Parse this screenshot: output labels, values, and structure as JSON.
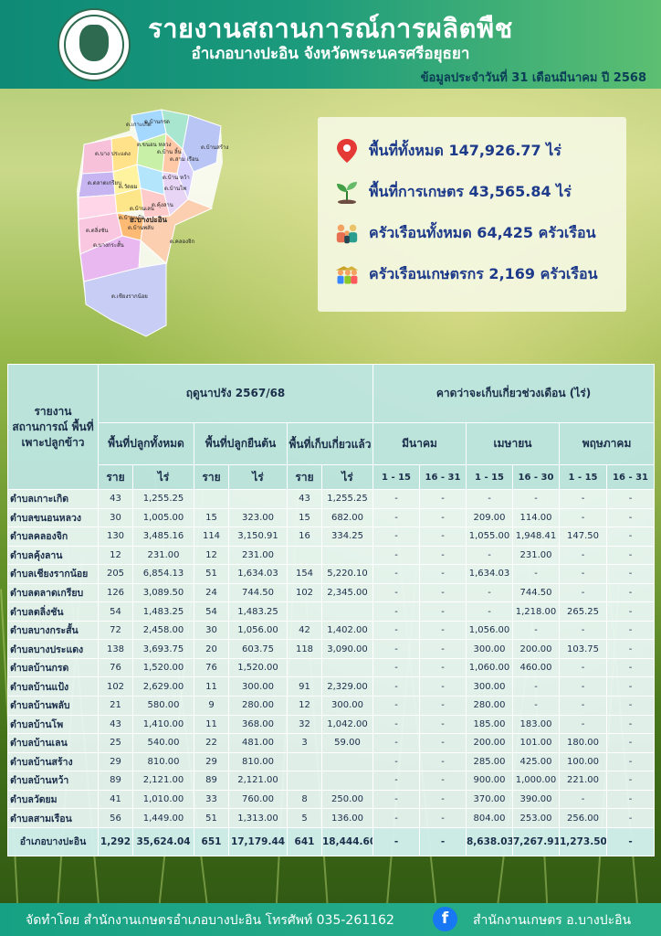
{
  "header": {
    "title": "รายงานสถานการณ์การผลิตพืช",
    "subtitle": "อำเภอบางปะอิน จังหวัดพระนครศรีอยุธยา",
    "date": "ข้อมูลประจำวันที่  31  เดือนมีนาคม ปี 2568"
  },
  "map": {
    "labels": [
      "ต.บ้านกรด",
      "ต.ขนอน หลวง",
      "ต.บาง ประแดง",
      "ต.ตลาดเกรียบ",
      "ต.วัดยม",
      "ต.บ้านแป้ง",
      "ต.บ้านพลับ",
      "ต.บ้านเลน",
      "ต.บ้านโพ",
      "ต.คุ้งลาน",
      "ต.สาม เรือน",
      "ต.บ้านสร้าง",
      "ต.บ้าน หว้า",
      "ต.เกาะเกิด",
      "ต.บางกระสั้น",
      "ต.คลองจิก",
      "ต.เชียงรากน้อย",
      "อ.บางปะอิน",
      "ต.ตลิ่งชัน",
      "ต.บ้าน ลิ้น"
    ]
  },
  "info": {
    "total_area": "พื้นที่ทั้งหมด 147,926.77 ไร่",
    "agri_area": "พื้นที่การเกษตร 43,565.84 ไร่",
    "households": "ครัวเรือนทั้งหมด 64,425 ครัวเรือน",
    "farm_households": "ครัวเรือนเกษตรกร 2,169 ครัวเรือน"
  },
  "table": {
    "h_report": "รายงาน สถานการณ์ พื้นที่ เพาะปลูกข้าว",
    "h_season": "ฤดูนาปรัง 2567/68",
    "h_forecast": "คาดว่าจะเก็บเกี่ยวช่วงเดือน (ไร่)",
    "h_planted": "พื้นที่ปลูกทั้งหมด",
    "h_standing": "พื้นที่ปลูกยืนต้น",
    "h_harvested": "พื้นที่เก็บเกี่ยวแล้ว",
    "h_mar": "มีนาคม",
    "h_apr": "เมษายน",
    "h_may": "พฤษภาคม",
    "u_rai": "ราย",
    "u_area": "ไร่",
    "p_mar1": "1 - 15",
    "p_mar2": "16 - 31",
    "p_apr1": "1 - 15",
    "p_apr2": "16 - 30",
    "p_may1": "1 - 15",
    "p_may2": "16 - 31",
    "rows": [
      [
        "ตำบลเกาะเกิด",
        "43",
        "1,255.25",
        "",
        "",
        "43",
        "1,255.25",
        "-",
        "-",
        "-",
        "-",
        "-",
        "-"
      ],
      [
        "ตำบลขนอนหลวง",
        "30",
        "1,005.00",
        "15",
        "323.00",
        "15",
        "682.00",
        "-",
        "-",
        "209.00",
        "114.00",
        "-",
        "-"
      ],
      [
        "ตำบลคลองจิก",
        "130",
        "3,485.16",
        "114",
        "3,150.91",
        "16",
        "334.25",
        "-",
        "-",
        "1,055.00",
        "1,948.41",
        "147.50",
        "-"
      ],
      [
        "ตำบลคุ้งลาน",
        "12",
        "231.00",
        "12",
        "231.00",
        "",
        "",
        "-",
        "-",
        "-",
        "231.00",
        "-",
        "-"
      ],
      [
        "ตำบลเชียงรากน้อย",
        "205",
        "6,854.13",
        "51",
        "1,634.03",
        "154",
        "5,220.10",
        "-",
        "-",
        "1,634.03",
        "-",
        "-",
        "-"
      ],
      [
        "ตำบลตลาดเกรียบ",
        "126",
        "3,089.50",
        "24",
        "744.50",
        "102",
        "2,345.00",
        "-",
        "-",
        "-",
        "744.50",
        "-",
        "-"
      ],
      [
        "ตำบลตลิ่งชัน",
        "54",
        "1,483.25",
        "54",
        "1,483.25",
        "",
        "",
        "-",
        "-",
        "-",
        "1,218.00",
        "265.25",
        "-"
      ],
      [
        "ตำบลบางกระสั้น",
        "72",
        "2,458.00",
        "30",
        "1,056.00",
        "42",
        "1,402.00",
        "-",
        "-",
        "1,056.00",
        "-",
        "-",
        "-"
      ],
      [
        "ตำบลบางประแดง",
        "138",
        "3,693.75",
        "20",
        "603.75",
        "118",
        "3,090.00",
        "-",
        "-",
        "300.00",
        "200.00",
        "103.75",
        "-"
      ],
      [
        "ตำบลบ้านกรด",
        "76",
        "1,520.00",
        "76",
        "1,520.00",
        "",
        "",
        "-",
        "-",
        "1,060.00",
        "460.00",
        "-",
        "-"
      ],
      [
        "ตำบลบ้านแป้ง",
        "102",
        "2,629.00",
        "11",
        "300.00",
        "91",
        "2,329.00",
        "-",
        "-",
        "300.00",
        "-",
        "-",
        "-"
      ],
      [
        "ตำบลบ้านพลับ",
        "21",
        "580.00",
        "9",
        "280.00",
        "12",
        "300.00",
        "-",
        "-",
        "280.00",
        "-",
        "-",
        "-"
      ],
      [
        "ตำบลบ้านโพ",
        "43",
        "1,410.00",
        "11",
        "368.00",
        "32",
        "1,042.00",
        "-",
        "-",
        "185.00",
        "183.00",
        "-",
        "-"
      ],
      [
        "ตำบลบ้านเลน",
        "25",
        "540.00",
        "22",
        "481.00",
        "3",
        "59.00",
        "-",
        "-",
        "200.00",
        "101.00",
        "180.00",
        "-"
      ],
      [
        "ตำบลบ้านสร้าง",
        "29",
        "810.00",
        "29",
        "810.00",
        "",
        "",
        "-",
        "-",
        "285.00",
        "425.00",
        "100.00",
        "-"
      ],
      [
        "ตำบลบ้านหว้า",
        "89",
        "2,121.00",
        "89",
        "2,121.00",
        "",
        "",
        "-",
        "-",
        "900.00",
        "1,000.00",
        "221.00",
        "-"
      ],
      [
        "ตำบลวัดยม",
        "41",
        "1,010.00",
        "33",
        "760.00",
        "8",
        "250.00",
        "-",
        "-",
        "370.00",
        "390.00",
        "-",
        "-"
      ],
      [
        "ตำบลสามเรือน",
        "56",
        "1,449.00",
        "51",
        "1,313.00",
        "5",
        "136.00",
        "-",
        "-",
        "804.00",
        "253.00",
        "256.00",
        "-"
      ]
    ],
    "total": [
      "อำเภอบางปะอิน",
      "1,292",
      "35,624.04",
      "651",
      "17,179.44",
      "641",
      "18,444.60",
      "-",
      "-",
      "8,638.03",
      "7,267.91",
      "1,273.50",
      "-"
    ]
  },
  "footer": {
    "left": "จัดทำโดย  สำนักงานเกษตรอำเภอบางปะอิน  โทรศัพท์  035-261162",
    "fb": "f",
    "right": "สำนักงานเกษตร อ.บางปะอิน"
  }
}
